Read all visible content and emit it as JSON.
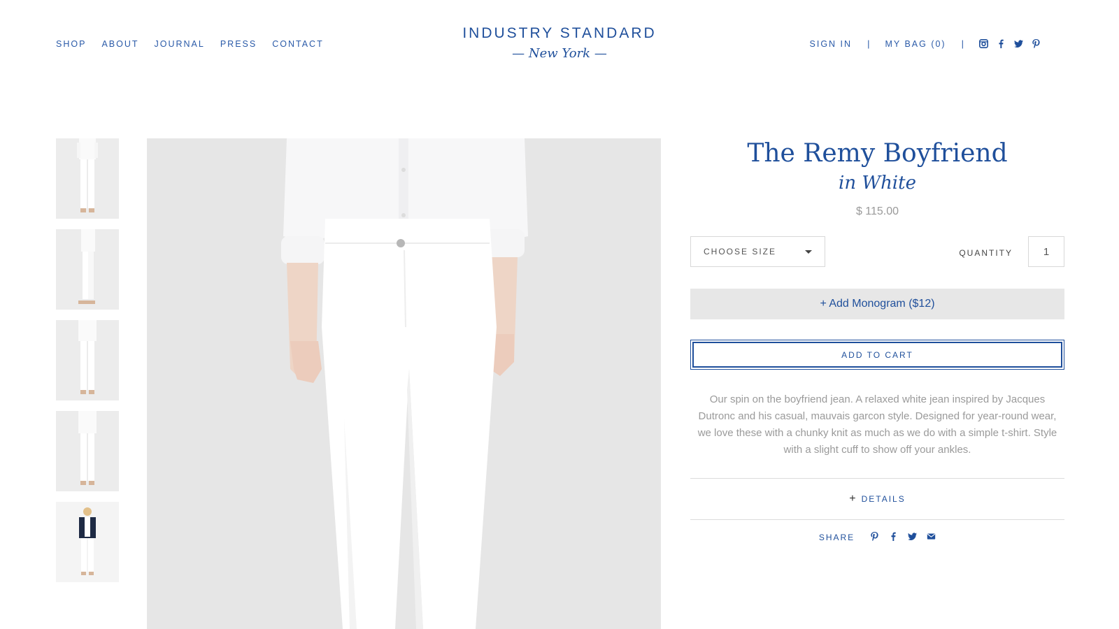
{
  "header": {
    "nav_left": [
      "SHOP",
      "ABOUT",
      "JOURNAL",
      "PRESS",
      "CONTACT"
    ],
    "logo": {
      "brand": "INDUSTRY STANDARD",
      "city": "— New York —"
    },
    "sign_in": "SIGN IN",
    "separator": "|",
    "bag": "MY BAG (0)",
    "social_icons": [
      "instagram-icon",
      "facebook-icon",
      "twitter-icon",
      "pinterest-icon"
    ]
  },
  "gallery": {
    "thumbnail_count": 5,
    "main_image_alt": "model wearing white jeans and white shirt"
  },
  "product": {
    "title": "The Remy Boyfriend",
    "color_label": "in White",
    "price": "$ 115.00",
    "size_select": {
      "label": "CHOOSE SIZE"
    },
    "quantity": {
      "label": "QUANTITY",
      "value": "1"
    },
    "monogram_button": "+ Add Monogram ($12)",
    "add_to_cart": "ADD TO CART",
    "description": "Our spin on the boyfriend jean. A relaxed white jean inspired by Jacques Dutronc and his casual, mauvais garcon style. Designed for year-round wear, we love these with a chunky knit as much as we do with a simple t-shirt. Style with a slight cuff to show off your ankles.",
    "details": {
      "plus": "+",
      "label": "DETAILS"
    },
    "share": {
      "label": "SHARE",
      "icons": [
        "pinterest-icon",
        "facebook-icon",
        "twitter-icon",
        "email-icon"
      ]
    }
  },
  "colors": {
    "brand_blue": "#1f4f9b",
    "muted_text": "#9a9a9a",
    "button_gray": "#e7e7e7"
  }
}
